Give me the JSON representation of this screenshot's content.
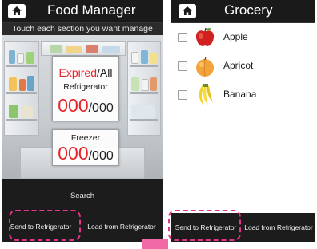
{
  "left_screen": {
    "title": "Food Manager",
    "subtitle": "Touch each section you want manage",
    "refrigerator_card": {
      "expired_word": "Expired",
      "slash": "/",
      "all_word": "All",
      "label": "Refrigerator",
      "expired_count": "000",
      "total_count": "/000"
    },
    "freezer_card": {
      "label": "Freezer",
      "expired_count": "000",
      "total_count": "/000"
    },
    "menu": {
      "search_label": "Search",
      "send_label": "Send to Refrigerator",
      "load_label": "Load from Refrigerator"
    }
  },
  "right_screen": {
    "title": "Grocery",
    "items": [
      {
        "label": "Apple",
        "icon": "apple-icon"
      },
      {
        "label": "Apricot",
        "icon": "apricot-icon"
      },
      {
        "label": "Banana",
        "icon": "banana-icon"
      }
    ],
    "send_label": "Send to Refrigerator",
    "load_label": "Load from Refrigerator"
  },
  "colors": {
    "highlight": "#e4338c",
    "expired_red": "#e8232a",
    "header_bg": "#1a1a1a"
  }
}
